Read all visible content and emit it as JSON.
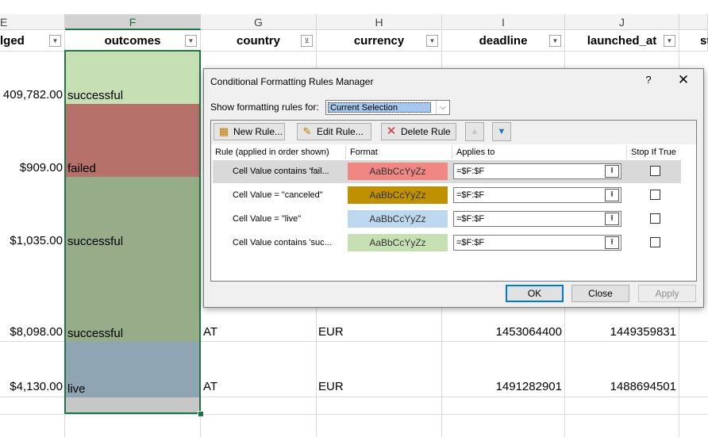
{
  "sheet": {
    "column_letters": [
      "E",
      "F",
      "G",
      "H",
      "I",
      "J",
      ""
    ],
    "headers": [
      "lged",
      "outcomes",
      "country",
      "currency",
      "deadline",
      "launched_at",
      "st"
    ],
    "pledged": [
      "409,782.00",
      "$909.00",
      "$1,035.00",
      "$8,098.00",
      "$4,130.00"
    ],
    "outcomes": [
      "successful",
      "failed",
      "successful",
      "successful",
      "live"
    ],
    "country": [
      "",
      "",
      "",
      "AT",
      "AT"
    ],
    "currency": [
      "",
      "",
      "",
      "EUR",
      "EUR"
    ],
    "deadline": [
      "",
      "",
      "",
      "1453064400",
      "1491282901"
    ],
    "launched_at": [
      "",
      "",
      "",
      "1449359831",
      "1488694501"
    ],
    "colors": {
      "successful": "#c6e0b4",
      "failed": "#b5716a",
      "successful_dark": "#97ac89",
      "live": "#8fa5b4",
      "gray": "#c7c7c7",
      "selection": "#217346"
    }
  },
  "dialog": {
    "title": "Conditional Formatting Rules Manager",
    "help": "?",
    "close": "✕",
    "show_label": "Show formatting rules for:",
    "show_value": "Current Selection",
    "buttons": {
      "new_rule": "New Rule...",
      "edit_rule": "Edit Rule...",
      "delete_rule": "Delete Rule",
      "move_up": "▲",
      "move_down": "▼"
    },
    "columns": [
      "Rule (applied in order shown)",
      "Format",
      "Applies to",
      "Stop If True"
    ],
    "rules": [
      {
        "rule": "Cell Value contains 'fail...",
        "format": "AaBbCcYyZz",
        "applies_to": "=$F:$F",
        "color": "#f08784",
        "text_color": "#333333"
      },
      {
        "rule": "Cell Value = \"canceled\"",
        "format": "AaBbCcYyZz",
        "applies_to": "=$F:$F",
        "color": "#bf9000",
        "text_color": "#333333"
      },
      {
        "rule": "Cell Value = \"live\"",
        "format": "AaBbCcYyZz",
        "applies_to": "=$F:$F",
        "color": "#bdd7ee",
        "text_color": "#333333"
      },
      {
        "rule": "Cell Value contains 'suc...",
        "format": "AaBbCcYyZz",
        "applies_to": "=$F:$F",
        "color": "#c6e0b4",
        "text_color": "#333333"
      }
    ],
    "ok": "OK",
    "close_button": "Close",
    "apply": "Apply"
  }
}
